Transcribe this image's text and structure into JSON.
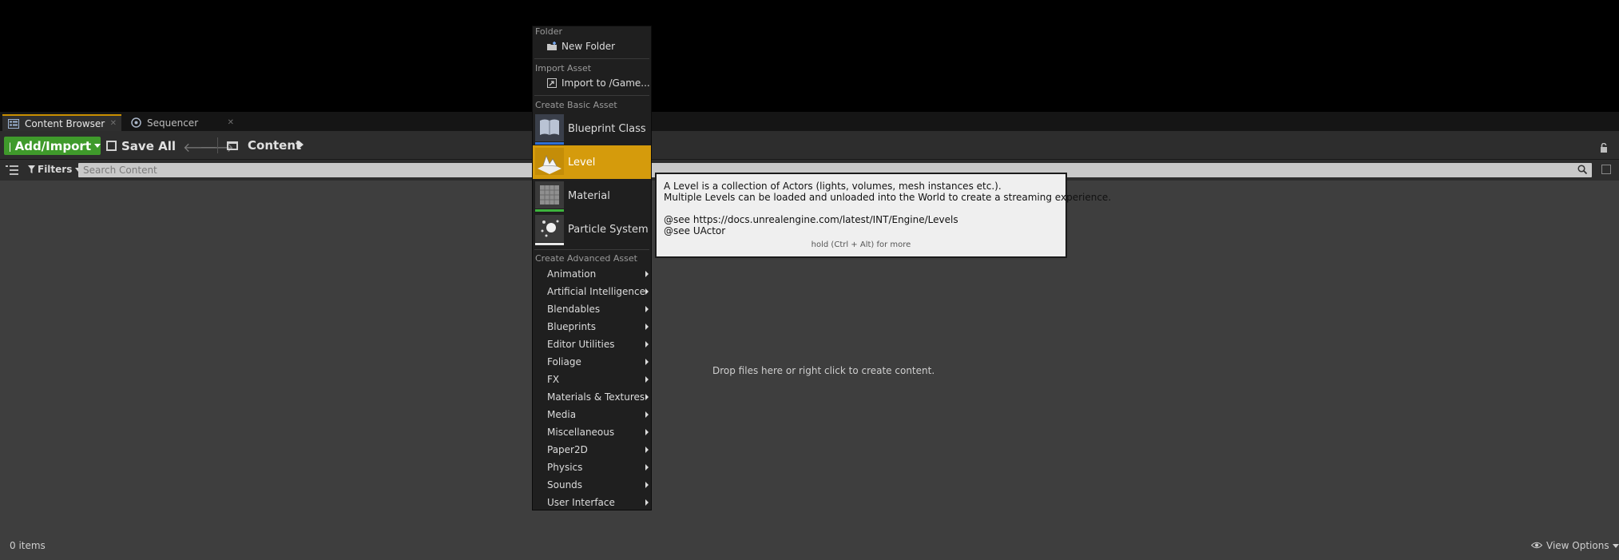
{
  "tabs": [
    {
      "label": "Content Browser",
      "active": true,
      "icon": "content-browser-icon"
    },
    {
      "label": "Sequencer",
      "active": false,
      "icon": "sequencer-icon"
    }
  ],
  "toolbar": {
    "add_import_label": "Add/Import",
    "save_all_label": "Save All",
    "folder_label": "Content"
  },
  "filterbar": {
    "filters_label": "Filters",
    "search_placeholder": "Search Content"
  },
  "main": {
    "empty_hint": "Drop files here or right click to create content."
  },
  "status": {
    "items_count": "0 items",
    "view_options_label": "View Options"
  },
  "menu": {
    "section_folder": "Folder",
    "new_folder": "New Folder",
    "section_import": "Import Asset",
    "import_to": "Import to /Game...",
    "section_basic": "Create Basic Asset",
    "basic_items": [
      {
        "label": "Blueprint Class",
        "bar_color": "#2f6fd3",
        "icon": "blueprint-class-icon"
      },
      {
        "label": "Level",
        "bar_color": "#d59b0c",
        "icon": "level-icon"
      },
      {
        "label": "Material",
        "bar_color": "#3db33d",
        "icon": "material-icon"
      },
      {
        "label": "Particle System",
        "bar_color": "#e8e8e8",
        "icon": "particle-system-icon"
      }
    ],
    "section_advanced": "Create Advanced Asset",
    "advanced_items": [
      "Animation",
      "Artificial Intelligence",
      "Blendables",
      "Blueprints",
      "Editor Utilities",
      "Foliage",
      "FX",
      "Materials & Textures",
      "Media",
      "Miscellaneous",
      "Paper2D",
      "Physics",
      "Sounds",
      "User Interface"
    ]
  },
  "tooltip": {
    "line1": "A Level is a collection of Actors (lights, volumes, mesh instances etc.).",
    "line2": "Multiple Levels can be loaded and unloaded into the World to create a streaming experience.",
    "line3": "@see https://docs.unrealengine.com/latest/INT/Engine/Levels",
    "line4": "@see UActor",
    "more": "hold (Ctrl + Alt) for more"
  },
  "colors": {
    "accent": "#d59b0c",
    "add_button": "#3f9a2b",
    "panel_bg": "#3e3e3e"
  }
}
